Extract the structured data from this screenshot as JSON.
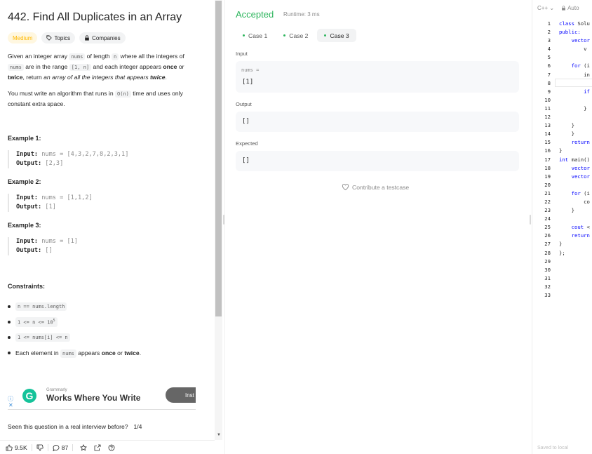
{
  "problem": {
    "title": "442. Find All Duplicates in an Array",
    "difficulty": "Medium",
    "tags": [
      "Topics",
      "Companies"
    ],
    "description": {
      "p1_a": "Given an integer array ",
      "p1_code1": "nums",
      "p1_b": " of length ",
      "p1_code2": "n",
      "p1_c": " where all the integers of",
      "p1_code3": "nums",
      "p1_d": " are in the range ",
      "p1_code4": "[1, n]",
      "p1_e": " and each integer appears ",
      "p1_once": "once",
      "p1_f": " or",
      "p1_twice": "twice",
      "p1_g": ", return ",
      "p1_em": "an array of all the integers that appears ",
      "p1_em_b": "twice",
      "p1_h": ".",
      "p2_a": "You must write an algorithm that runs in ",
      "p2_code": "O(n)",
      "p2_b": " time and uses only",
      "p2_c": "constant extra space."
    },
    "examples": [
      {
        "title": "Example 1:",
        "input_label": "Input:",
        "input": "nums = [4,3,2,7,8,2,3,1]",
        "output_label": "Output:",
        "output": "[2,3]"
      },
      {
        "title": "Example 2:",
        "input_label": "Input:",
        "input": "nums = [1,1,2]",
        "output_label": "Output:",
        "output": "[1]"
      },
      {
        "title": "Example 3:",
        "input_label": "Input:",
        "input": "nums = [1]",
        "output_label": "Output:",
        "output": "[]"
      }
    ],
    "constraints_title": "Constraints:",
    "constraints": {
      "c1": "n == nums.length",
      "c2": "1 <= n <= 10",
      "c2_sup": "5",
      "c3": "1 <= nums[i] <= n",
      "c4_a": "Each element in ",
      "c4_code": "nums",
      "c4_b": " appears ",
      "c4_once": "once",
      "c4_c": " or ",
      "c4_twice": "twice",
      "c4_d": "."
    }
  },
  "ad": {
    "brand": "Grammarly",
    "slogan": "Works Where You Write",
    "button": "Inst",
    "logo_letter": "G"
  },
  "seen": {
    "text": "Seen this question in a real interview before?",
    "count": "1/4"
  },
  "bottom_bar": {
    "likes": "9.5K",
    "comments": "87"
  },
  "result": {
    "status": "Accepted",
    "runtime": "Runtime: 3 ms",
    "cases": [
      "Case 1",
      "Case 2",
      "Case 3"
    ],
    "active_case": 2,
    "input_label": "Input",
    "input_var": "nums =",
    "input_value": "[1]",
    "output_label": "Output",
    "output_value": "[]",
    "expected_label": "Expected",
    "expected_value": "[]",
    "contribute": "Contribute a testcase"
  },
  "editor": {
    "language": "C++",
    "mode": "Auto",
    "saved": "Saved to local",
    "line_numbers": [
      "1",
      "2",
      "3",
      "4",
      "5",
      "6",
      "7",
      "8",
      "9",
      "10",
      "11",
      "12",
      "13",
      "14",
      "15",
      "16",
      "17",
      "18",
      "19",
      "20",
      "21",
      "22",
      "23",
      "24",
      "25",
      "26",
      "27",
      "28",
      "29",
      "30",
      "31",
      "32",
      "33"
    ],
    "lines": [
      "class Solu",
      "public:",
      "    vector",
      "        v",
      "",
      "    for (i",
      "        in",
      "",
      "        if",
      "",
      "        }",
      "",
      "    }",
      "    }",
      "    return",
      "}",
      "int main()",
      "    vector",
      "    vector",
      "",
      "    for (i",
      "        co",
      "    }",
      "",
      "    cout <",
      "    return",
      "}",
      "};",
      "",
      "",
      "",
      "",
      ""
    ]
  },
  "colors": {
    "accepted": "#2db55d",
    "medium": "#ffb800",
    "grammarly": "#15c39a"
  }
}
